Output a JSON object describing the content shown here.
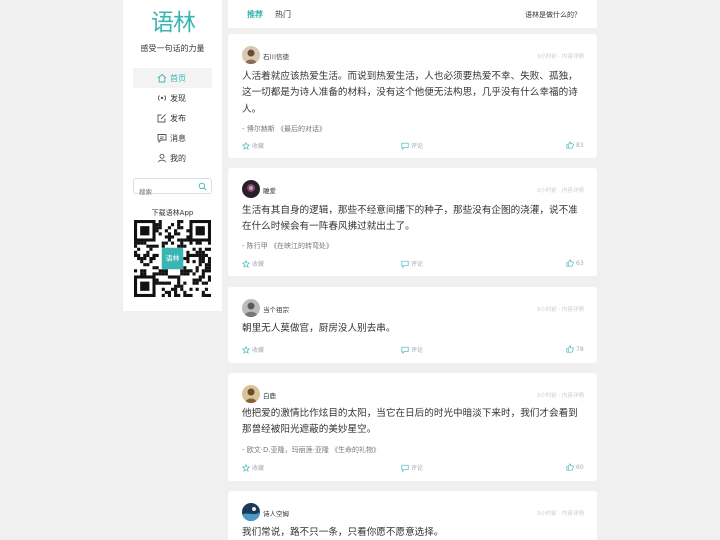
{
  "brand": {
    "logo_text": "语林",
    "slogan": "感受一句话的力量"
  },
  "nav": [
    {
      "id": "home",
      "label": "首页",
      "icon": "home-icon",
      "active": true
    },
    {
      "id": "discover",
      "label": "发现",
      "icon": "broadcast-icon",
      "active": false
    },
    {
      "id": "publish",
      "label": "发布",
      "icon": "edit-icon",
      "active": false
    },
    {
      "id": "messages",
      "label": "消息",
      "icon": "message-icon",
      "active": false
    },
    {
      "id": "me",
      "label": "我的",
      "icon": "user-icon",
      "active": false
    }
  ],
  "search": {
    "placeholder": "搜索"
  },
  "download": {
    "label": "下载语林App"
  },
  "qr": {
    "center_text": "语林"
  },
  "topbar": {
    "tabs": [
      "推荐",
      "热门"
    ],
    "about": "语林是做什么的？"
  },
  "actions": {
    "collect": "收藏",
    "comment": "评论"
  },
  "colors": {
    "accent": "#3bb4b4",
    "background": "#f0f0f0"
  },
  "posts": [
    {
      "author": "石川信徳",
      "meta": "3小时前 · 内容详情",
      "content": "人活着就应该热爱生活。而说到热爱生活，人也必须要热爱不幸、失败、孤独，这一切都是为诗人准备的材料，没有这个他便无法构思，几乎没有什么幸福的诗人。",
      "source": "- 博尔赫斯 《最后的对话》",
      "likes": "83"
    },
    {
      "author": "雕爱",
      "meta": "3小时前 · 内容详情",
      "content": "生活有其自身的逻辑，那些不经意间播下的种子，那些没有企图的浇灌，说不准在什么时候会有一阵春风拂过就出土了。",
      "source": "- 陈行甲 《在峡江的转弯处》",
      "likes": "63"
    },
    {
      "author": "当个祖宗",
      "meta": "3小时前 · 内容详情",
      "content": "朝里无人莫做官，厨房没人别去串。",
      "source": "",
      "likes": "78"
    },
    {
      "author": "白鹿",
      "meta": "3小时前 · 内容详情",
      "content": "他把爱的激情比作炫目的太阳，当它在日后的时光中暗淡下来时，我们才会看到那曾经被阳光遮蔽的美妙星空。",
      "source": "- 欧文·D.亚隆，玛丽莲·亚隆 《生命的礼物》",
      "likes": "60"
    },
    {
      "author": "诗人空姆",
      "meta": "3小时前 · 内容详情",
      "content": "我们常说，路不只一条，只看你愿不愿意选择。",
      "source": "",
      "likes": ""
    }
  ]
}
